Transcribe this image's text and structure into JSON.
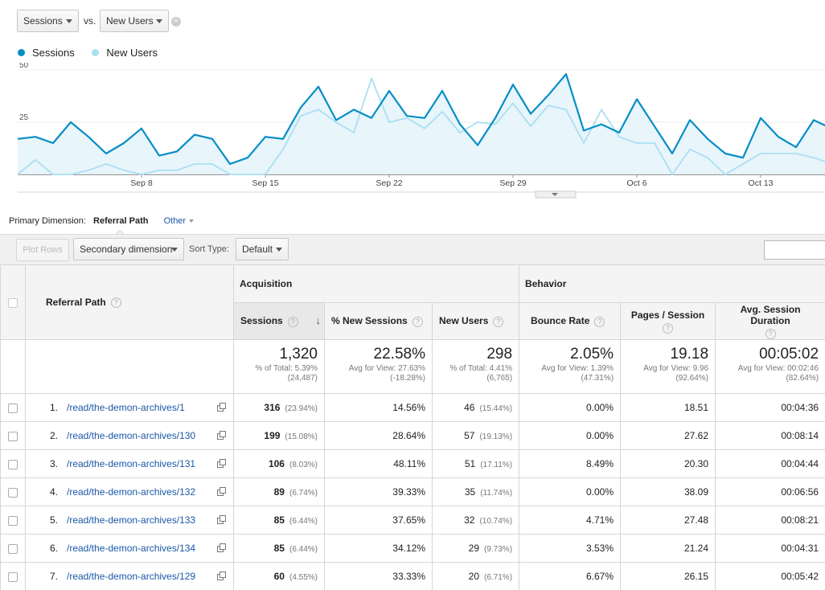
{
  "compare": {
    "metric1": "Sessions",
    "vs_label": "vs.",
    "metric2": "New Users"
  },
  "legend": [
    {
      "name": "Sessions",
      "color": "#058dc7"
    },
    {
      "name": "New Users",
      "color": "#aadff3"
    }
  ],
  "chart_data": {
    "type": "line",
    "y_ticks": [
      50,
      25
    ],
    "ylim": [
      0,
      50
    ],
    "x_tick_labels": [
      "Sep 8",
      "Sep 15",
      "Sep 22",
      "Sep 29",
      "Oct 6",
      "Oct 13"
    ],
    "x_tick_indices": [
      7,
      14,
      21,
      28,
      35,
      42
    ],
    "series": [
      {
        "name": "Sessions",
        "color": "#058dc7",
        "values": [
          17,
          18,
          15,
          25,
          18,
          10,
          15,
          22,
          9,
          11,
          19,
          17,
          5,
          8,
          18,
          17,
          32,
          42,
          26,
          31,
          27,
          40,
          28,
          27,
          40,
          24,
          14,
          27,
          43,
          29,
          38,
          48,
          21,
          24,
          20,
          36,
          23,
          10,
          26,
          17,
          10,
          8,
          27,
          18,
          13,
          26,
          22
        ]
      },
      {
        "name": "New Users",
        "color": "#aadff3",
        "values": [
          0,
          7,
          0,
          0,
          2,
          5,
          2,
          0,
          2,
          2,
          5,
          5,
          0,
          0,
          0,
          12,
          28,
          31,
          25,
          20,
          46,
          25,
          27,
          22,
          30,
          20,
          25,
          24,
          34,
          23,
          33,
          31,
          15,
          31,
          18,
          15,
          15,
          0,
          12,
          8,
          0,
          5,
          10,
          10,
          10,
          8,
          5
        ]
      }
    ]
  },
  "primary_dimension": {
    "label": "Primary Dimension:",
    "value": "Referral Path",
    "other": "Other"
  },
  "toolbar": {
    "plot_rows": "Plot Rows",
    "secondary_dimension": "Secondary dimension",
    "sort_type_label": "Sort Type:",
    "sort_type_value": "Default"
  },
  "table": {
    "dimension_header": "Referral Path",
    "help_glyph": "?",
    "sort_arrow": "↓",
    "group_acquisition": "Acquisition",
    "group_behavior": "Behavior",
    "col_sessions": "Sessions",
    "col_new_sessions": "% New Sessions",
    "col_new_users": "New Users",
    "col_bounce": "Bounce Rate",
    "col_pages": "Pages / Session",
    "col_duration": "Avg. Session Duration",
    "totals": {
      "sessions": {
        "value": "1,320",
        "line1": "% of Total: 5.39%",
        "line2": "(24,487)"
      },
      "new_sessions": {
        "value": "22.58%",
        "line1": "Avg for View: 27.63%",
        "line2": "(-18.28%)"
      },
      "new_users": {
        "value": "298",
        "line1": "% of Total: 4.41%",
        "line2": "(6,765)"
      },
      "bounce": {
        "value": "2.05%",
        "line1": "Avg for View: 1.39%",
        "line2": "(47.31%)"
      },
      "pages": {
        "value": "19.18",
        "line1": "Avg for View: 9.96",
        "line2": "(92.64%)"
      },
      "duration": {
        "value": "00:05:02",
        "line1": "Avg for View: 00:02:46",
        "line2": "(82.64%)"
      }
    },
    "rows": [
      {
        "index": "1.",
        "path": "/read/the-demon-archives/1",
        "sessions": "316",
        "sessions_pct": "(23.94%)",
        "new_sessions": "14.56%",
        "new_users": "46",
        "new_users_pct": "(15.44%)",
        "bounce": "0.00%",
        "pages": "18.51",
        "duration": "00:04:36"
      },
      {
        "index": "2.",
        "path": "/read/the-demon-archives/130",
        "sessions": "199",
        "sessions_pct": "(15.08%)",
        "new_sessions": "28.64%",
        "new_users": "57",
        "new_users_pct": "(19.13%)",
        "bounce": "0.00%",
        "pages": "27.62",
        "duration": "00:08:14"
      },
      {
        "index": "3.",
        "path": "/read/the-demon-archives/131",
        "sessions": "106",
        "sessions_pct": "(8.03%)",
        "new_sessions": "48.11%",
        "new_users": "51",
        "new_users_pct": "(17.11%)",
        "bounce": "8.49%",
        "pages": "20.30",
        "duration": "00:04:44"
      },
      {
        "index": "4.",
        "path": "/read/the-demon-archives/132",
        "sessions": "89",
        "sessions_pct": "(6.74%)",
        "new_sessions": "39.33%",
        "new_users": "35",
        "new_users_pct": "(11.74%)",
        "bounce": "0.00%",
        "pages": "38.09",
        "duration": "00:06:56"
      },
      {
        "index": "5.",
        "path": "/read/the-demon-archives/133",
        "sessions": "85",
        "sessions_pct": "(6.44%)",
        "new_sessions": "37.65%",
        "new_users": "32",
        "new_users_pct": "(10.74%)",
        "bounce": "4.71%",
        "pages": "27.48",
        "duration": "00:08:21"
      },
      {
        "index": "6.",
        "path": "/read/the-demon-archives/134",
        "sessions": "85",
        "sessions_pct": "(6.44%)",
        "new_sessions": "34.12%",
        "new_users": "29",
        "new_users_pct": "(9.73%)",
        "bounce": "3.53%",
        "pages": "21.24",
        "duration": "00:04:31"
      },
      {
        "index": "7.",
        "path": "/read/the-demon-archives/129",
        "sessions": "60",
        "sessions_pct": "(4.55%)",
        "new_sessions": "33.33%",
        "new_users": "20",
        "new_users_pct": "(6.71%)",
        "bounce": "6.67%",
        "pages": "26.15",
        "duration": "00:05:42"
      }
    ]
  }
}
